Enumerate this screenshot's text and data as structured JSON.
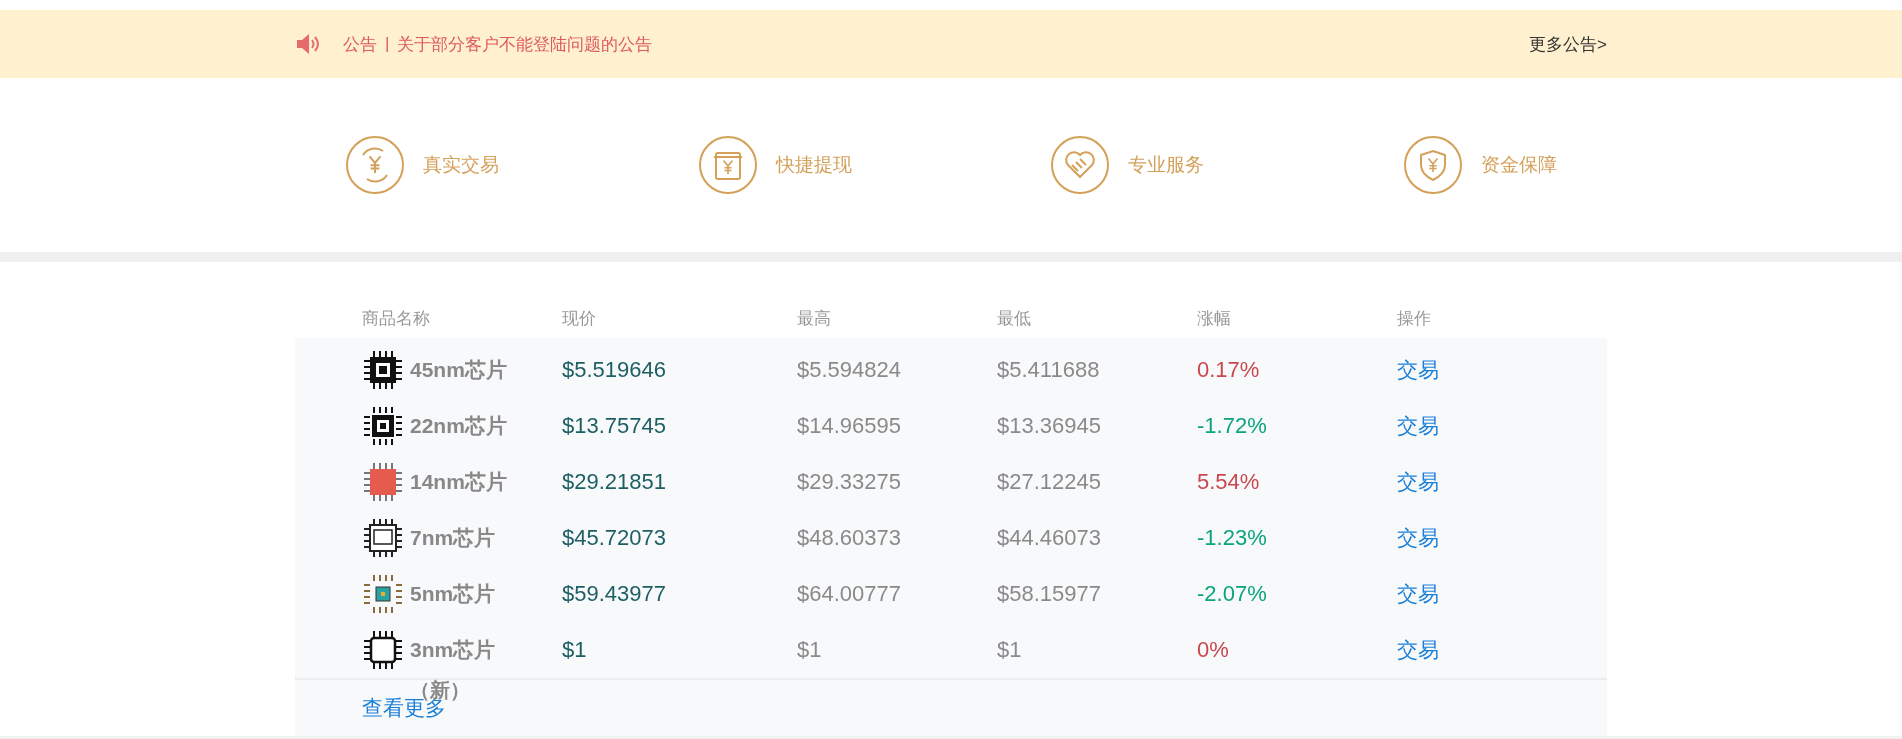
{
  "notice": {
    "label": "公告",
    "separator": "|",
    "text": "关于部分客户不能登陆问题的公告",
    "more": "更多公告>"
  },
  "features": [
    {
      "kind": "exchange",
      "label": "真实交易"
    },
    {
      "kind": "withdraw",
      "label": "快捷提现"
    },
    {
      "kind": "handshake",
      "label": "专业服务"
    },
    {
      "kind": "shield",
      "label": "资金保障"
    }
  ],
  "table": {
    "columns": [
      "商品名称",
      "现价",
      "最高",
      "最低",
      "涨幅",
      "操作"
    ],
    "rows": [
      {
        "kind": "solid",
        "name": "45nm芯片",
        "price": "$5.519646",
        "high": "$5.594824",
        "low": "$5.411688",
        "change": "0.17%",
        "color": "#c9474f",
        "action": "交易"
      },
      {
        "kind": "small",
        "name": "22nm芯片",
        "price": "$13.75745",
        "high": "$14.96595",
        "low": "$13.36945",
        "change": "-1.72%",
        "color": "#0aa47e",
        "action": "交易"
      },
      {
        "kind": "red",
        "name": "14nm芯片",
        "price": "$29.21851",
        "high": "$29.33275",
        "low": "$27.12245",
        "change": "5.54%",
        "color": "#c9474f",
        "action": "交易"
      },
      {
        "kind": "board",
        "name": "7nm芯片",
        "price": "$45.72073",
        "high": "$48.60373",
        "low": "$44.46073",
        "change": "-1.23%",
        "color": "#0aa47e",
        "action": "交易"
      },
      {
        "kind": "circuit",
        "name": "5nm芯片",
        "price": "$59.43977",
        "high": "$64.00777",
        "low": "$58.15977",
        "change": "-2.07%",
        "color": "#0aa47e",
        "action": "交易"
      },
      {
        "kind": "outline",
        "name": "3nm芯片",
        "note": "（新）",
        "price": "$1",
        "high": "$1",
        "low": "$1",
        "change": "0%",
        "color": "#c9474f",
        "action": "交易"
      }
    ],
    "more": "查看更多"
  }
}
